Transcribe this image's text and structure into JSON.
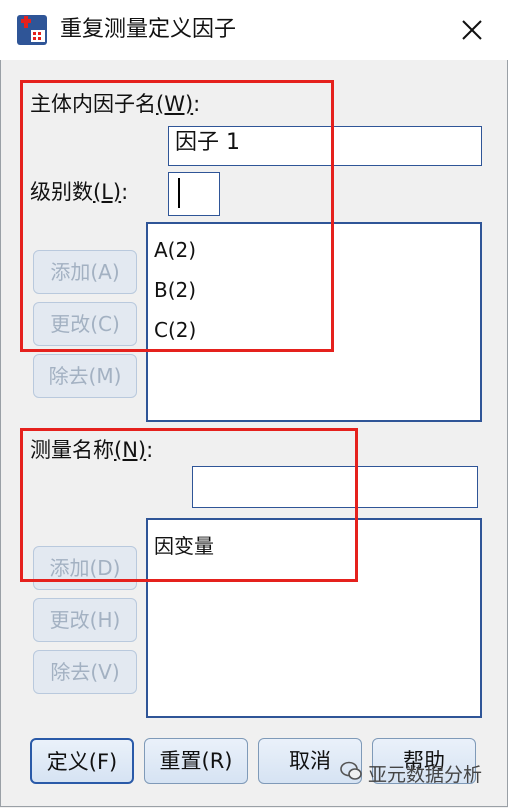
{
  "window": {
    "title": "重复测量定义因子"
  },
  "within_factor": {
    "label": "主体内因子名",
    "mnemonic": "(W)",
    "colon": ":",
    "name_value": "因子 1",
    "levels_label": "级别数",
    "levels_mnemonic": "(L)",
    "levels_colon": ":",
    "levels_value": "",
    "list": [
      "A(2)",
      "B(2)",
      "C(2)"
    ],
    "buttons": {
      "add": "添加(A)",
      "change": "更改(C)",
      "remove": "除去(M)"
    }
  },
  "measure": {
    "label": "测量名称",
    "mnemonic": "(N)",
    "colon": ":",
    "name_value": "",
    "list": [
      "因变量"
    ],
    "buttons": {
      "add": "添加(D)",
      "change": "更改(H)",
      "remove": "除去(V)"
    }
  },
  "footer": {
    "define": "定义(F)",
    "reset": "重置(R)",
    "cancel": "取消",
    "help": "帮助"
  },
  "watermark": {
    "text": "亚元数据分析"
  },
  "colors": {
    "accent": "#2f5597",
    "highlight_border": "#e5211d",
    "button_face": "#d6e3f3"
  }
}
